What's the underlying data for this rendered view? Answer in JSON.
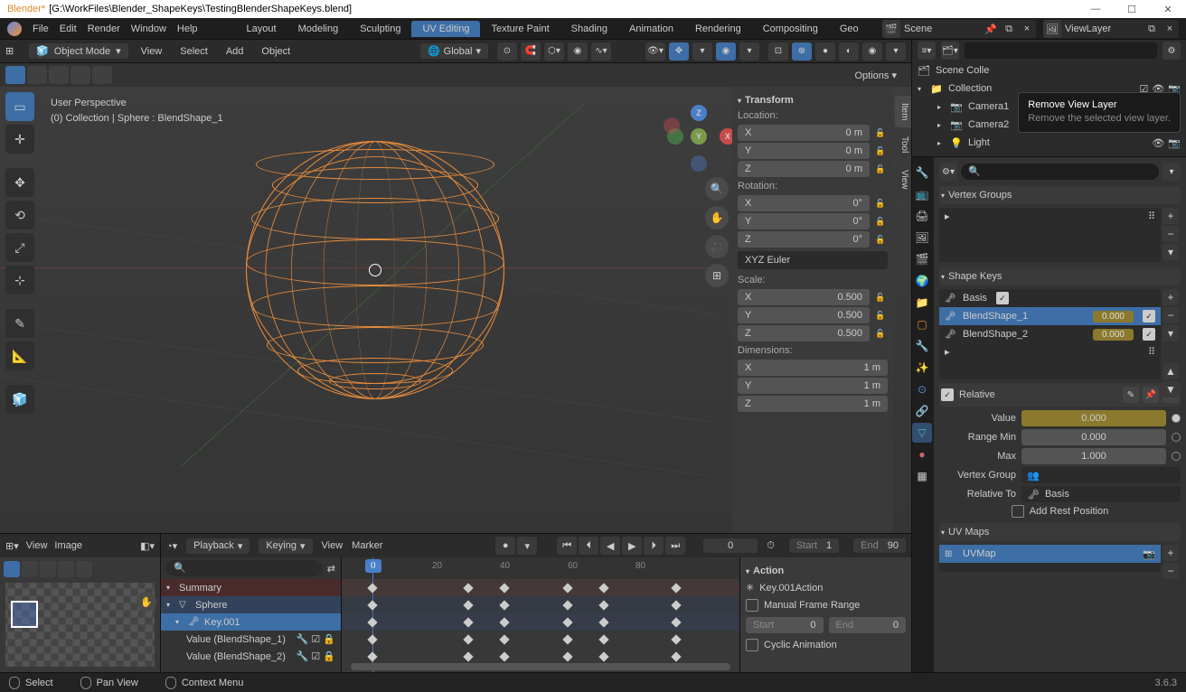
{
  "window": {
    "app": "Blender*",
    "path": "[G:\\WorkFiles\\Blender_ShapeKeys\\TestingBlenderShapeKeys.blend]"
  },
  "top_menu": [
    "File",
    "Edit",
    "Render",
    "Window",
    "Help"
  ],
  "workspaces": [
    "Layout",
    "Modeling",
    "Sculpting",
    "UV Editing",
    "Texture Paint",
    "Shading",
    "Animation",
    "Rendering",
    "Compositing",
    "Geo"
  ],
  "workspace_active": "UV Editing",
  "scene": {
    "name": "Scene"
  },
  "viewlayer": {
    "name": "ViewLayer"
  },
  "viewport": {
    "mode": "Object Mode",
    "menus": [
      "View",
      "Select",
      "Add",
      "Object"
    ],
    "orientation": "Global",
    "options": "Options",
    "overlay": {
      "persp": "User Perspective",
      "info": "(0) Collection | Sphere : BlendShape_1"
    }
  },
  "transform": {
    "title": "Transform",
    "location": {
      "label": "Location:",
      "x": "0 m",
      "y": "0 m",
      "z": "0 m"
    },
    "rotation": {
      "label": "Rotation:",
      "x": "0°",
      "y": "0°",
      "z": "0°",
      "mode": "XYZ Euler"
    },
    "scale": {
      "label": "Scale:",
      "x": "0.500",
      "y": "0.500",
      "z": "0.500"
    },
    "dimensions": {
      "label": "Dimensions:",
      "x": "1 m",
      "y": "1 m",
      "z": "1 m"
    }
  },
  "uv_editor": {
    "menus": [
      "View",
      "Image"
    ]
  },
  "timeline": {
    "menus": [
      "Playback",
      "Keying",
      "View",
      "Marker"
    ],
    "current": "0",
    "start_lbl": "Start",
    "start": "1",
    "end_lbl": "End",
    "end": "90",
    "ticks": [
      "20",
      "40",
      "60",
      "80"
    ],
    "tree": {
      "summary": "Summary",
      "object": "Sphere",
      "action": "Key.001",
      "ch1": "Value (BlendShape_1)",
      "ch2": "Value (BlendShape_2)"
    },
    "action_panel": {
      "title": "Action",
      "action_name": "Key.001Action",
      "manual": "Manual Frame Range",
      "start_lbl": "Start",
      "start": "0",
      "end_lbl": "End",
      "end": "0",
      "cyclic": "Cyclic Animation"
    }
  },
  "outliner": {
    "scene": "Scene Colle",
    "collection": "Collection",
    "items": [
      "Camera1",
      "Camera2",
      "Light"
    ]
  },
  "tooltip": {
    "title": "Remove View Layer",
    "desc": "Remove the selected view layer."
  },
  "properties": {
    "vertex_groups": {
      "title": "Vertex Groups"
    },
    "shape_keys": {
      "title": "Shape Keys",
      "items": [
        {
          "name": "Basis"
        },
        {
          "name": "BlendShape_1",
          "value": "0.000"
        },
        {
          "name": "BlendShape_2",
          "value": "0.000"
        }
      ],
      "relative": "Relative",
      "value_lbl": "Value",
      "value": "0.000",
      "range_min_lbl": "Range Min",
      "range_min": "0.000",
      "max_lbl": "Max",
      "max": "1.000",
      "vgroup_lbl": "Vertex Group",
      "rel_to_lbl": "Relative To",
      "rel_to": "Basis",
      "rest": "Add Rest Position"
    },
    "uv_maps": {
      "title": "UV Maps",
      "item": "UVMap"
    }
  },
  "status": {
    "select": "Select",
    "pan": "Pan View",
    "context": "Context Menu",
    "version": "3.6.3"
  }
}
